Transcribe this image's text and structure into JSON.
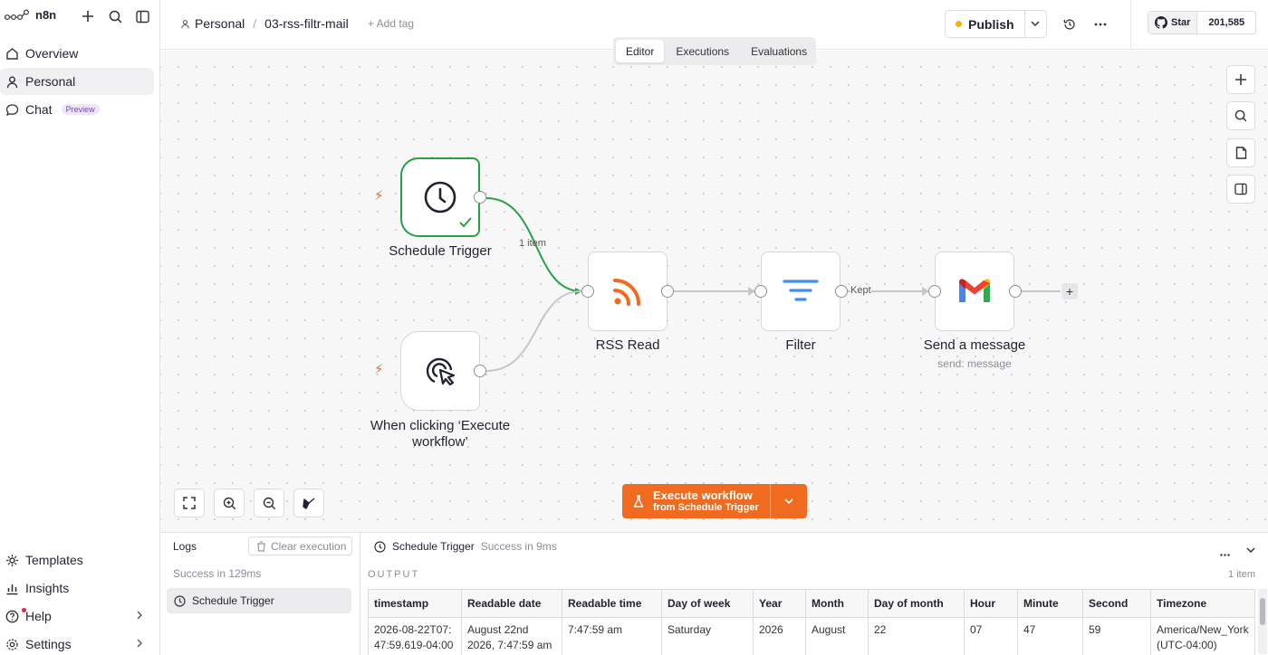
{
  "app": {
    "name": "n8n"
  },
  "sidebar": {
    "items": [
      {
        "label": "Overview"
      },
      {
        "label": "Personal"
      },
      {
        "label": "Chat",
        "badge": "Preview"
      }
    ],
    "bottom_items": [
      {
        "label": "Templates"
      },
      {
        "label": "Insights"
      },
      {
        "label": "Help"
      },
      {
        "label": "Settings"
      }
    ]
  },
  "header": {
    "breadcrumb_project": "Personal",
    "breadcrumb_sep": "/",
    "workflow_name": "03-rss-filtr-mail",
    "add_tag": "+ Add tag",
    "publish_label": "Publish",
    "github_star": "Star",
    "github_count": "201,585"
  },
  "tabs": [
    {
      "label": "Editor",
      "active": true
    },
    {
      "label": "Executions"
    },
    {
      "label": "Evaluations"
    }
  ],
  "nodes": {
    "schedule": {
      "label": "Schedule Trigger"
    },
    "manual": {
      "label": "When clicking ‘Execute workflow’"
    },
    "rss": {
      "label": "RSS Read"
    },
    "filter": {
      "label": "Filter"
    },
    "gmail": {
      "label": "Send a message",
      "sub": "send: message"
    }
  },
  "edges": {
    "schedule_rss": "1 item",
    "filter_gmail": "Kept"
  },
  "execute": {
    "title": "Execute workflow",
    "subtitle": "from Schedule Trigger"
  },
  "colors": {
    "accent": "#f06b1f",
    "success": "#25a244",
    "rss": "#f26b1d",
    "filter": "#3d8ff0"
  },
  "logs": {
    "title": "Logs",
    "clear": "Clear execution",
    "status": "Success in 129ms",
    "entry": "Schedule Trigger",
    "detail_node": "Schedule Trigger",
    "detail_status": "Success in 9ms",
    "output_label": "OUTPUT",
    "item_count": "1 item",
    "columns": [
      "timestamp",
      "Readable date",
      "Readable time",
      "Day of week",
      "Year",
      "Month",
      "Day of month",
      "Hour",
      "Minute",
      "Second",
      "Timezone"
    ],
    "row": [
      "2026-08-22T07:47:59.619-04:00",
      "August 22nd 2026, 7:47:59 am",
      "7:47:59 am",
      "Saturday",
      "2026",
      "August",
      "22",
      "07",
      "47",
      "59",
      "America/New_York (UTC-04:00)"
    ]
  }
}
